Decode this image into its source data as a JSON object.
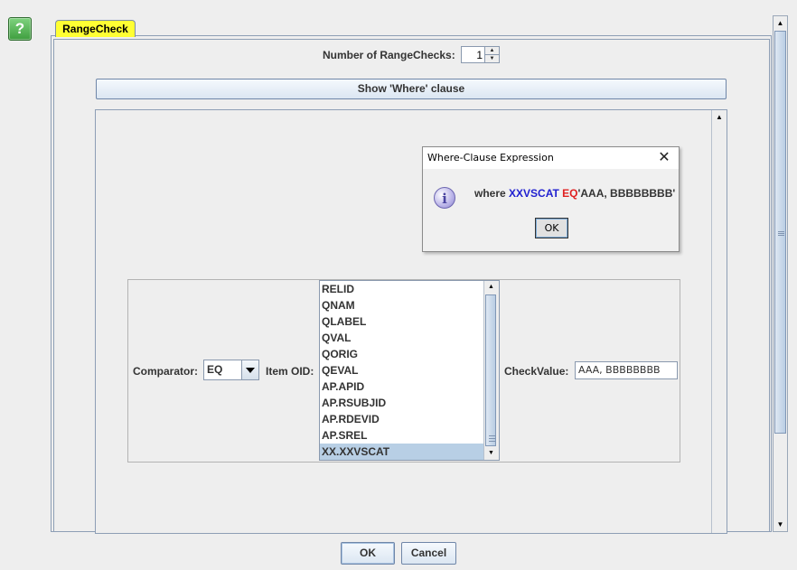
{
  "help": {
    "label": "?"
  },
  "tab": {
    "label": "RangeCheck"
  },
  "count": {
    "label": "Number of RangeChecks:",
    "value": "1"
  },
  "show_where": {
    "label": "Show 'Where' clause"
  },
  "dialog": {
    "title": "Where-Clause Expression",
    "message": {
      "prefix": "where",
      "variable": "XXVSCAT",
      "operator": "EQ",
      "value": "'AAA, BBBBBBBB'"
    },
    "ok_label": "OK",
    "colors": {
      "variable": "#2020d0",
      "operator": "#e02020"
    }
  },
  "criteria": {
    "comparator_label": "Comparator:",
    "comparator_value": "EQ",
    "item_oid_label": "Item OID:",
    "item_oids": [
      "RELID",
      "QNAM",
      "QLABEL",
      "QVAL",
      "QORIG",
      "QEVAL",
      "AP.APID",
      "AP.RSUBJID",
      "AP.RDEVID",
      "AP.SREL",
      "XX.XXVSCAT"
    ],
    "selected_oid": "XX.XXVSCAT",
    "checkvalue_label": "CheckValue:",
    "checkvalue": "AAA, BBBBBBBB"
  },
  "buttons": {
    "ok": "OK",
    "cancel": "Cancel"
  }
}
